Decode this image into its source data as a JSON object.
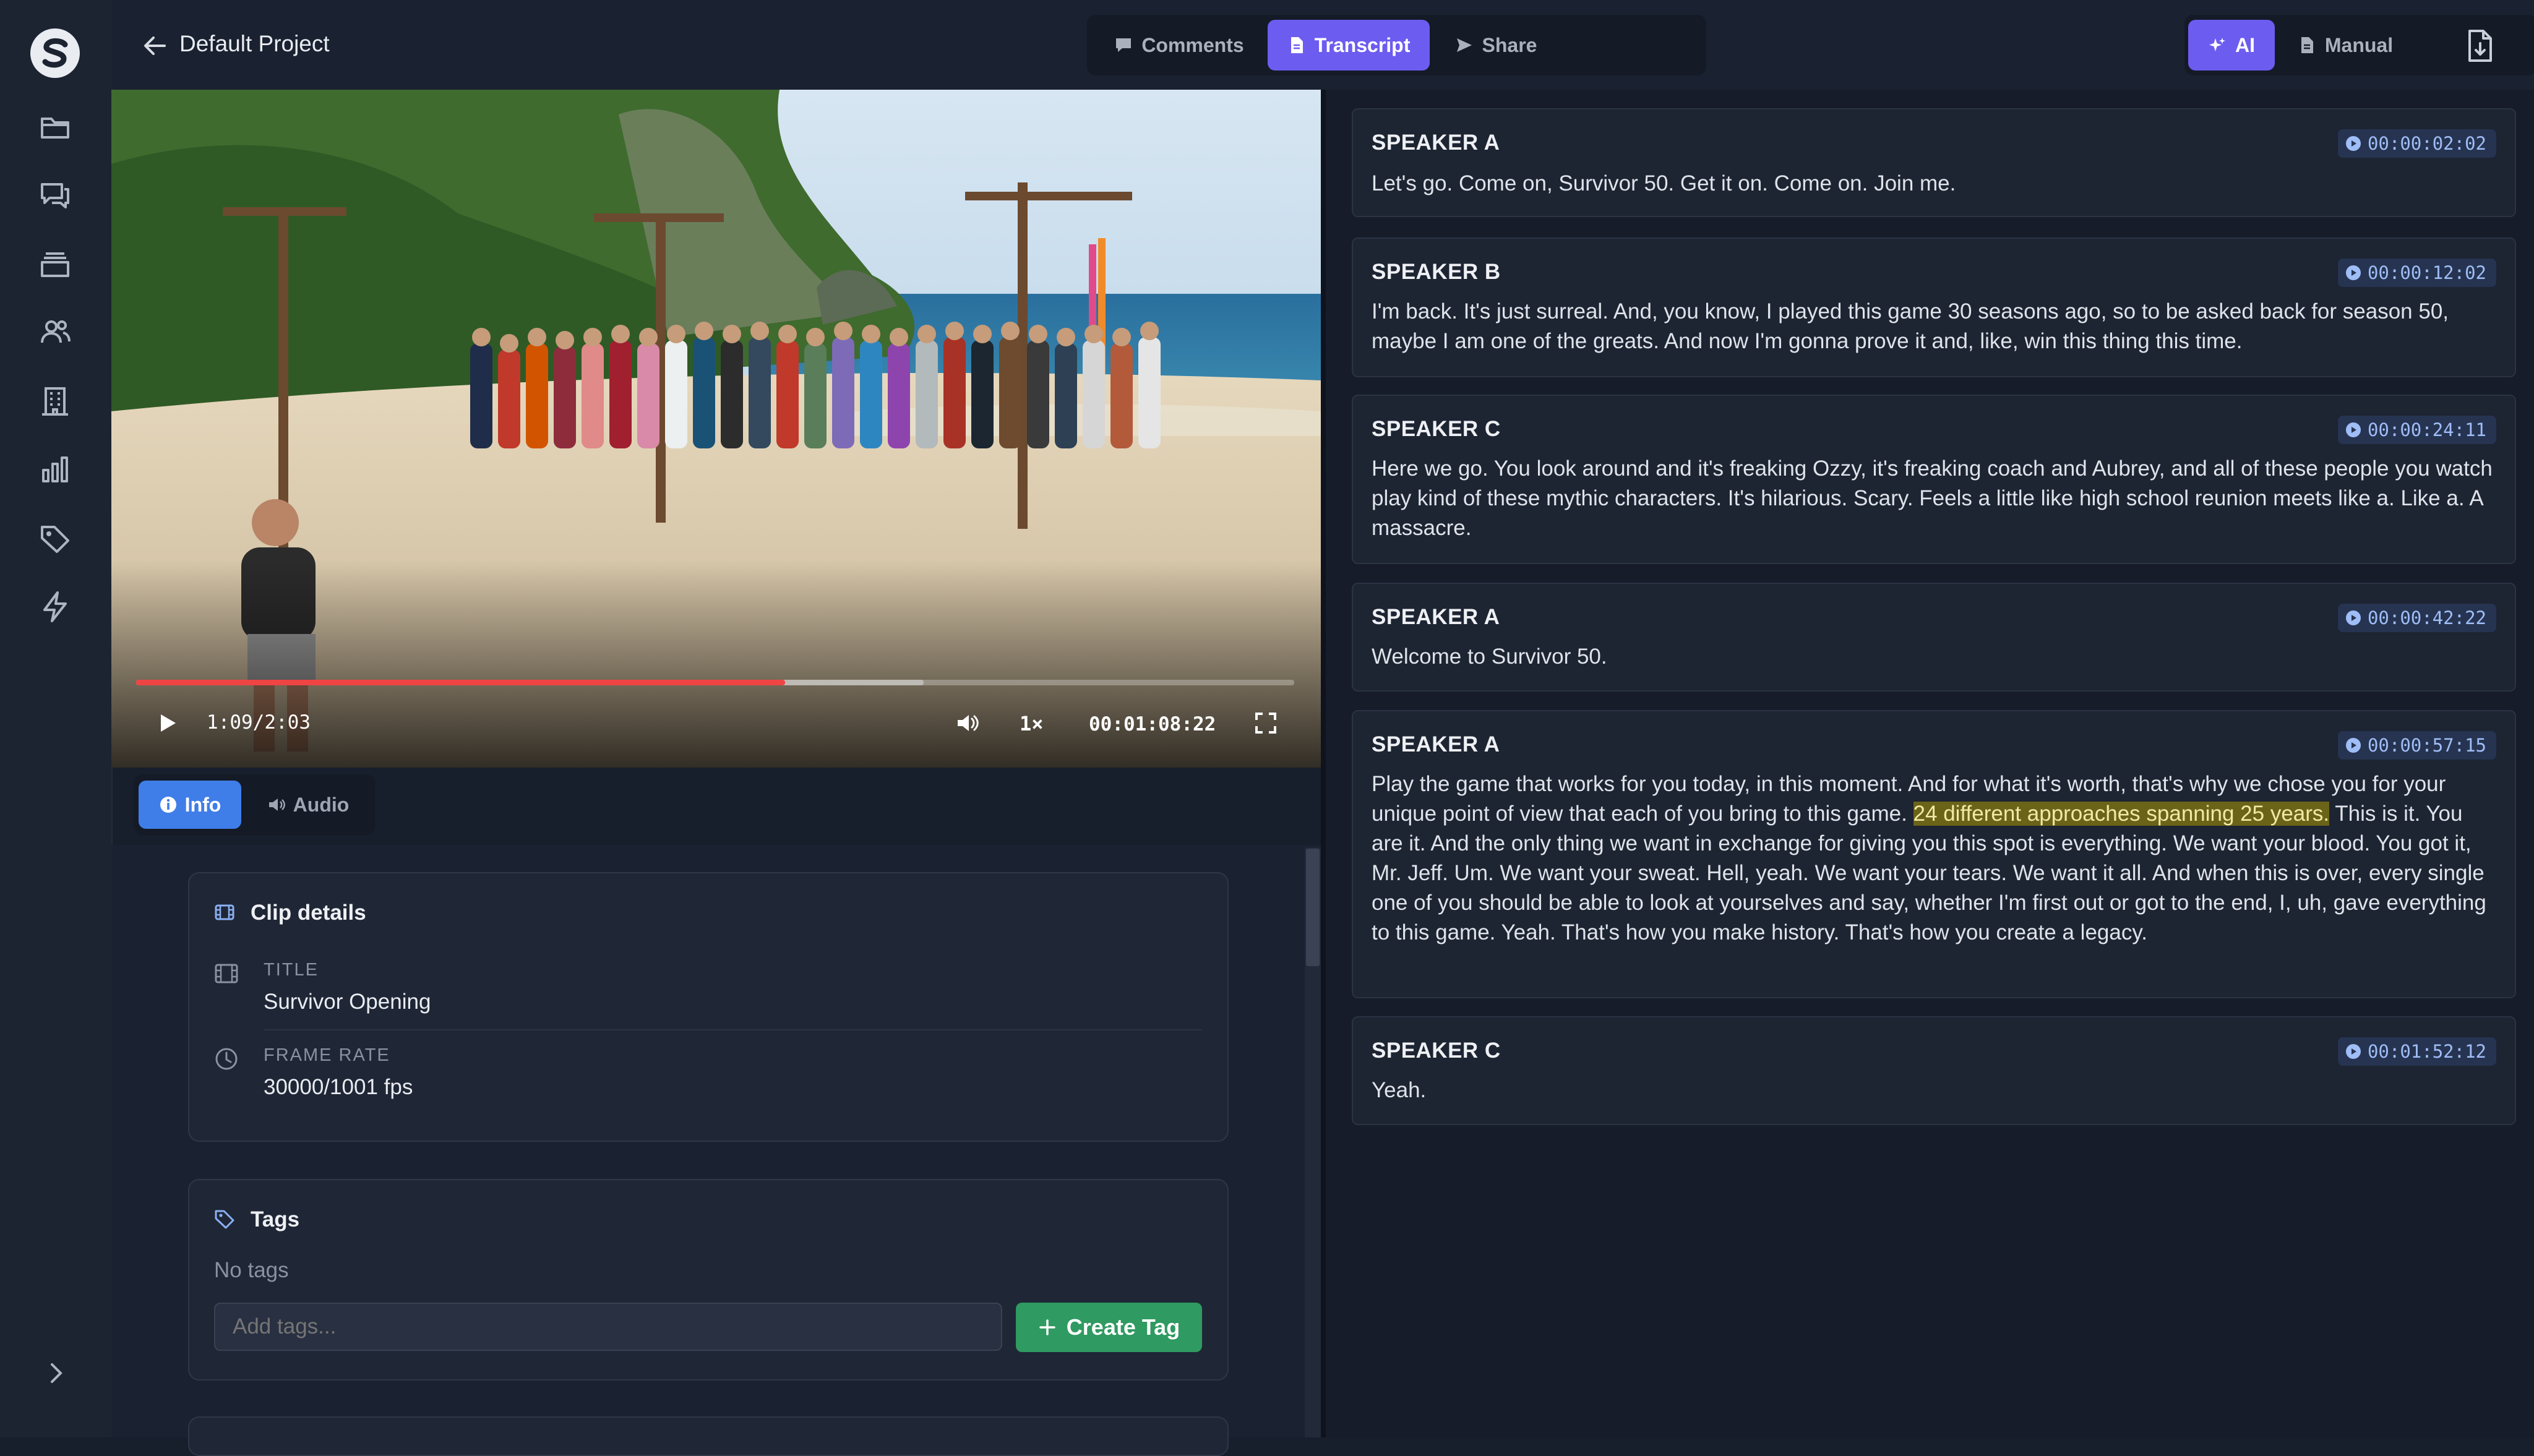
{
  "header": {
    "project_title": "Default Project",
    "view_tabs": [
      {
        "label": "Comments",
        "icon": "chat-bubble-icon"
      },
      {
        "label": "Transcript",
        "icon": "document-icon",
        "active": true
      },
      {
        "label": "Share",
        "icon": "send-icon"
      }
    ],
    "mode_tabs": [
      {
        "label": "AI",
        "icon": "sparkles-icon",
        "active": true
      },
      {
        "label": "Manual",
        "icon": "document-icon"
      }
    ]
  },
  "sidebar": {
    "items": [
      "folder-icon",
      "comments-icon",
      "archive-icon",
      "users-icon",
      "building-icon",
      "chart-icon",
      "tag-icon",
      "bolt-icon"
    ]
  },
  "player": {
    "current_time": "1:09",
    "separator": "/",
    "duration": "2:03",
    "speed": "1×",
    "timecode": "00:01:08:22",
    "progress": 0.5604,
    "buffered": 0.68
  },
  "info_tabs": [
    {
      "label": "Info",
      "icon": "info-icon",
      "active": true
    },
    {
      "label": "Audio",
      "icon": "speaker-icon"
    }
  ],
  "clip_details": {
    "heading": "Clip details",
    "fields": [
      {
        "label": "TITLE",
        "value": "Survivor Opening",
        "icon": "film-icon"
      },
      {
        "label": "FRAME RATE",
        "value": "30000/1001 fps",
        "icon": "clock-icon"
      }
    ]
  },
  "tags": {
    "heading": "Tags",
    "empty_text": "No tags",
    "input_placeholder": "Add tags...",
    "create_label": "Create Tag"
  },
  "transcript": {
    "segments": [
      {
        "speaker": "SPEAKER A",
        "time": "00:00:02:02",
        "text": "Let's go. Come on, Survivor 50. Get it on. Come on. Join me."
      },
      {
        "speaker": "SPEAKER B",
        "time": "00:00:12:02",
        "text": "I'm back. It's just surreal. And, you know, I played this game 30 seasons ago, so to be asked back for season 50, maybe I am one of the greats. And now I'm gonna prove it and, like, win this thing this time."
      },
      {
        "speaker": "SPEAKER C",
        "time": "00:00:24:11",
        "text": "Here we go. You look around and it's freaking Ozzy, it's freaking coach and Aubrey, and all of these people you watch play kind of these mythic characters. It's hilarious. Scary. Feels a little like high school reunion meets like a. Like a. A massacre."
      },
      {
        "speaker": "SPEAKER A",
        "time": "00:00:42:22",
        "text": "Welcome to Survivor 50."
      },
      {
        "speaker": "SPEAKER A",
        "time": "00:00:57:15",
        "text_before": "Play the game that works for you today, in this moment. And for what it's worth, that's why we chose you for your unique point of view that each of you bring to this game. ",
        "text_highlight": "24 different approaches spanning 25 years.",
        "text_after": " This is it. You are it. And the only thing we want in exchange for giving you this spot is everything. We want your blood. You got it, Mr. Jeff. Um. We want your sweat. Hell, yeah. We want your tears. We want it all. And when this is over, every single one of you should be able to look at yourselves and say, whether I'm first out or got to the end, I, uh, gave everything to this game. Yeah. That's how you make history. That's how you create a legacy."
      },
      {
        "speaker": "SPEAKER C",
        "time": "00:01:52:12",
        "text": "Yeah."
      }
    ]
  },
  "colors": {
    "accent": "#6d5cf0",
    "info_blue": "#3f7ee8",
    "create_green": "#2f9a61",
    "progress_red": "#ef4444",
    "highlight": "#6b6418"
  }
}
